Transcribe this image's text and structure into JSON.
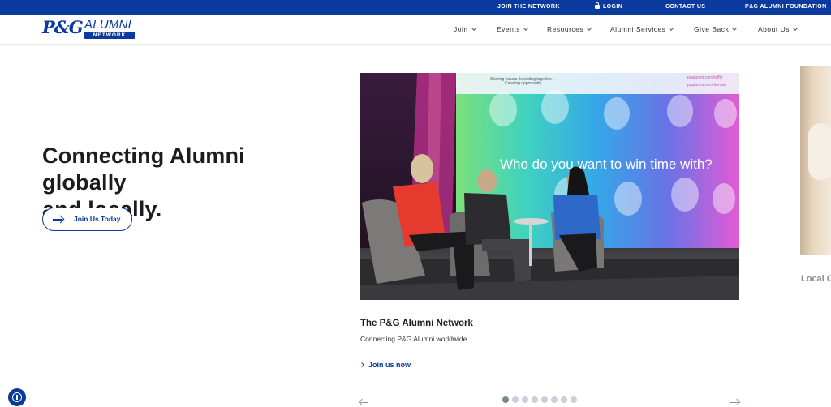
{
  "topbar": {
    "join_network": "JOIN THE NETWORK",
    "login": "LOGIN",
    "contact_us": "CONTACT US",
    "foundation": "P&G ALUMNI FOUNDATION"
  },
  "logo": {
    "pg": "P&G",
    "alumni": "ALUMNI",
    "network": "NETWORK"
  },
  "nav": {
    "items": [
      {
        "label": "Join"
      },
      {
        "label": "Events"
      },
      {
        "label": "Resources"
      },
      {
        "label": "Alumni Services"
      },
      {
        "label": "Give Back"
      },
      {
        "label": "About Us"
      }
    ]
  },
  "hero": {
    "title_line1": "Connecting Alumni globally",
    "title_line2": "and locally.",
    "cta_label": "Join Us Today"
  },
  "carousel": {
    "image_screen_text": "Who do you want to win time with?",
    "image_url_1": "pgalumni.com/raffle",
    "image_url_2": "pgalumni.com/donate",
    "image_tagline_1": "Sharing values. Investing together.",
    "image_tagline_2": "Creating opportunity",
    "slide_title": "The P&G Alumni Network",
    "slide_subtitle": "Connecting P&G Alumni worldwide.",
    "slide_link": "Join us now",
    "next_slide_label": "Local C",
    "dot_count": 8,
    "active_dot": 0
  },
  "colors": {
    "brand_blue": "#0a3a9e",
    "dot_inactive": "#c9d0dc",
    "dot_active": "#7b8798"
  },
  "icons": {
    "login": "lock-icon",
    "nav_dropdown": "chevron-down-icon",
    "cta": "arrow-right-icon",
    "prev": "arrow-left-icon",
    "next": "arrow-right-icon",
    "accessibility": "accessibility-icon"
  }
}
